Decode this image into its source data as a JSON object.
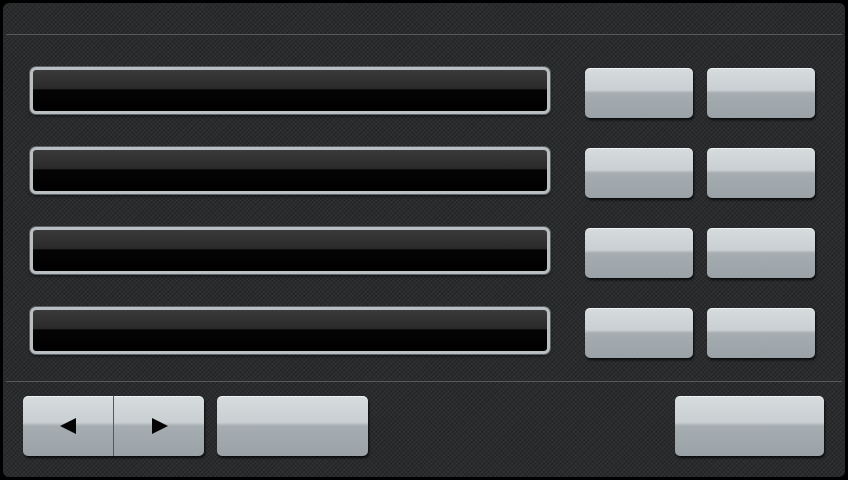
{
  "rows": [
    {
      "field_value": "",
      "button_a_label": "",
      "button_b_label": ""
    },
    {
      "field_value": "",
      "button_a_label": "",
      "button_b_label": ""
    },
    {
      "field_value": "",
      "button_a_label": "",
      "button_b_label": ""
    },
    {
      "field_value": "",
      "button_a_label": "",
      "button_b_label": ""
    }
  ],
  "footer": {
    "prev_icon": "left-arrow-icon",
    "next_icon": "right-arrow-icon",
    "middle_button_label": "",
    "right_button_label": ""
  },
  "colors": {
    "background": "#2a2c2e",
    "field_fill": "#000000",
    "field_border": "#b9bec1",
    "button_face": "#c9cfd2",
    "divider": "#55595c"
  }
}
